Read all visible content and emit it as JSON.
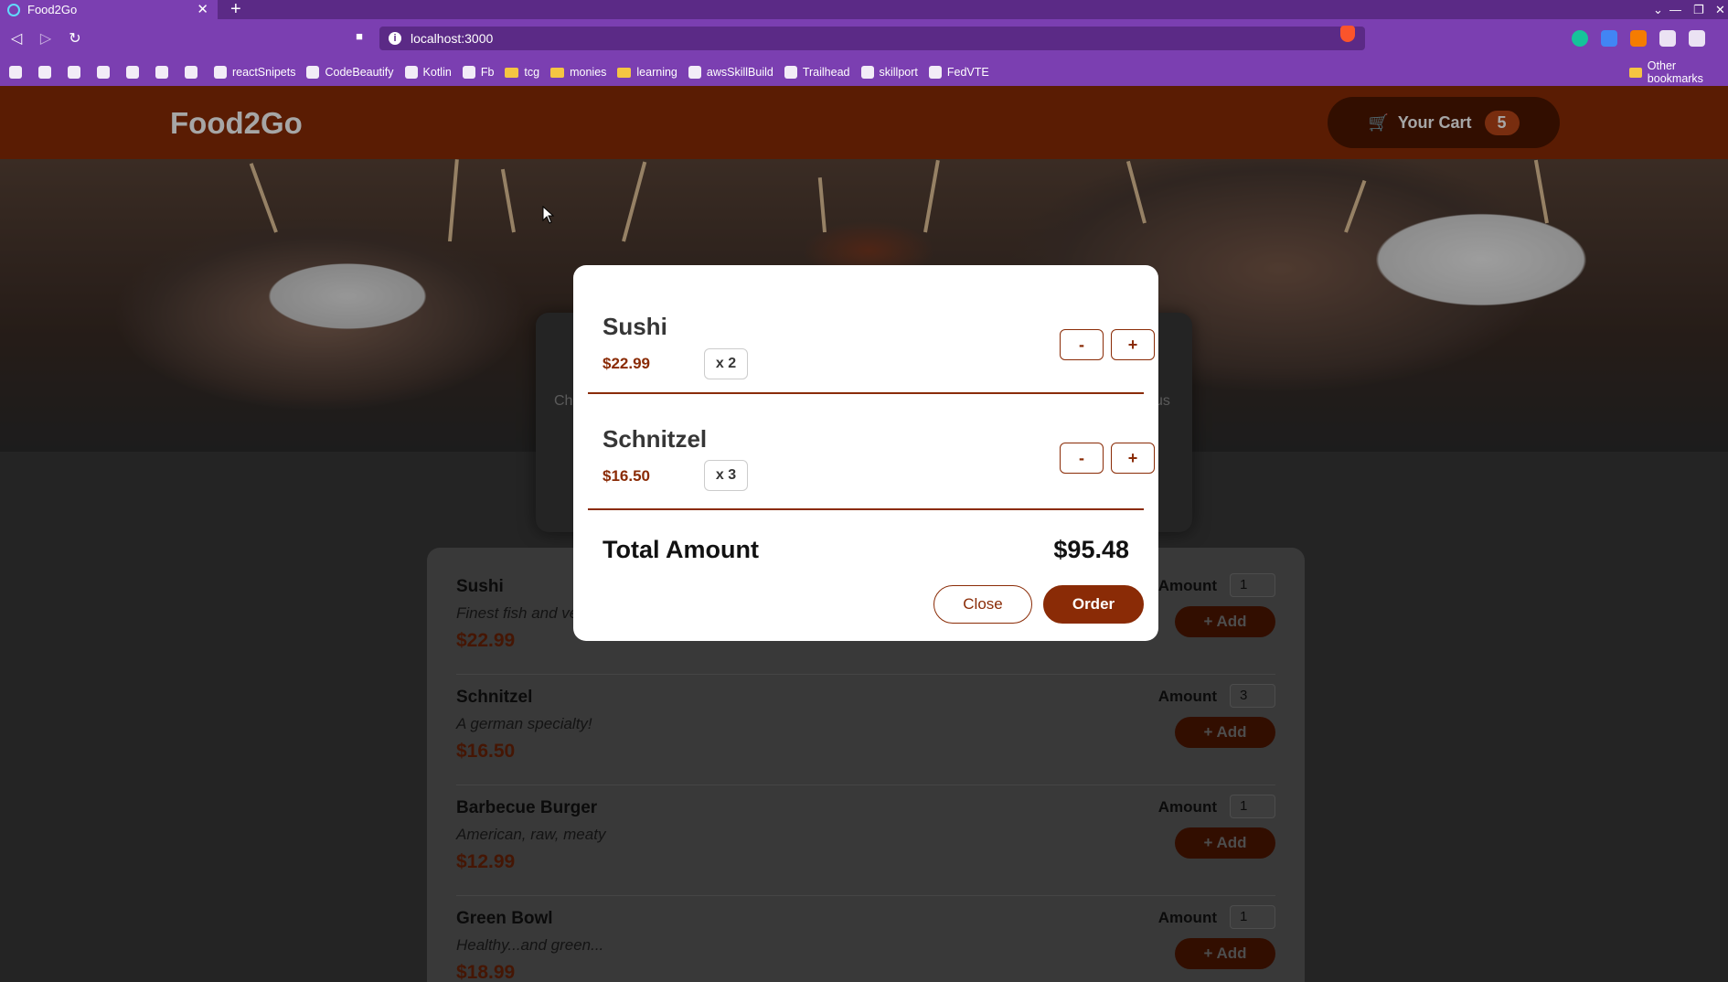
{
  "browser": {
    "tab_title": "Food2Go",
    "tab_close": "✕",
    "new_tab": "+",
    "url": "localhost:3000",
    "window_min": "—",
    "window_restore": "❐",
    "window_close": "✕",
    "bookmarks": [
      {
        "label": "",
        "icon": "gmail-icon"
      },
      {
        "label": "",
        "icon": "notion-icon"
      },
      {
        "label": "",
        "icon": "maps-icon"
      },
      {
        "label": "",
        "icon": "linkedin-icon"
      },
      {
        "label": "",
        "icon": "github-icon"
      },
      {
        "label": "",
        "icon": "app-icon"
      },
      {
        "label": "",
        "icon": "app-icon"
      },
      {
        "label": "reactSnipets",
        "icon": "github-icon"
      },
      {
        "label": "CodeBeautify",
        "icon": "codebeautify-icon"
      },
      {
        "label": "Kotlin",
        "icon": "kotlin-icon"
      },
      {
        "label": "Fb",
        "icon": "fb-icon"
      },
      {
        "label": "tcg",
        "icon": "folder-icon"
      },
      {
        "label": "monies",
        "icon": "folder-icon"
      },
      {
        "label": "learning",
        "icon": "folder-icon"
      },
      {
        "label": "awsSkillBuild",
        "icon": "aws-icon"
      },
      {
        "label": "Trailhead",
        "icon": "trailhead-icon"
      },
      {
        "label": "skillport",
        "icon": "skillport-icon"
      },
      {
        "label": "FedVTE",
        "icon": "fedvte-icon"
      }
    ],
    "other_bookmarks": "Other bookmarks"
  },
  "header": {
    "logo": "Food2Go",
    "cart_label": "Your Cart",
    "cart_count": "5"
  },
  "summary_fragments": {
    "left": "Ch",
    "right": "us"
  },
  "meals": [
    {
      "name": "Sushi",
      "description": "Finest fish and ve",
      "price": "$22.99",
      "amount_label": "Amount",
      "amount": "1",
      "add_label": "+ Add"
    },
    {
      "name": "Schnitzel",
      "description": "A german specialty!",
      "price": "$16.50",
      "amount_label": "Amount",
      "amount": "3",
      "add_label": "+ Add"
    },
    {
      "name": "Barbecue Burger",
      "description": "American, raw, meaty",
      "price": "$12.99",
      "amount_label": "Amount",
      "amount": "1",
      "add_label": "+ Add"
    },
    {
      "name": "Green Bowl",
      "description": "Healthy...and green...",
      "price": "$18.99",
      "amount_label": "Amount",
      "amount": "1",
      "add_label": "+ Add"
    }
  ],
  "cart_modal": {
    "items": [
      {
        "name": "Sushi",
        "price": "$22.99",
        "quantity": "x 2",
        "minus": "-",
        "plus": "+"
      },
      {
        "name": "Schnitzel",
        "price": "$16.50",
        "quantity": "x 3",
        "minus": "-",
        "plus": "+"
      }
    ],
    "total_label": "Total Amount",
    "total_value": "$95.48",
    "close_label": "Close",
    "order_label": "Order"
  },
  "colors": {
    "brand": "#8a2b06",
    "browser_frame": "#7b3fb1",
    "browser_tabbar": "#5b2a86"
  }
}
